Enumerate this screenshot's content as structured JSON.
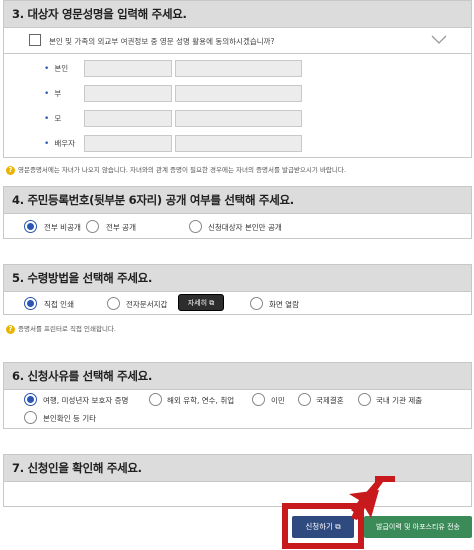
{
  "section3": {
    "title": "3. 대상자 영문성명을 입력해 주세요.",
    "consent_text": "본인 및 가족의 외교부 여권정보 중 영문 성명 활용에 동의하시겠습니까?",
    "rows": [
      {
        "label": "본인"
      },
      {
        "label": "부"
      },
      {
        "label": "모"
      },
      {
        "label": "배우자"
      }
    ],
    "note": "영문증명서에는 자녀가 나오지 않습니다. 자녀와의 관계 증명이 필요한 경우에는 자녀의 증명서를 발급받으시기 바랍니다."
  },
  "section4": {
    "title": "4. 주민등록번호(뒷부분 6자리) 공개 여부를 선택해 주세요.",
    "options": [
      {
        "label": "전부 비공개",
        "selected": true
      },
      {
        "label": "전부 공개",
        "selected": false
      },
      {
        "label": "신청대상자 본인만 공개",
        "selected": false
      }
    ]
  },
  "section5": {
    "title": "5. 수령방법을 선택해 주세요.",
    "options": [
      {
        "label": "직접 인쇄",
        "selected": true
      },
      {
        "label": "전자문서지갑",
        "selected": false
      },
      {
        "label": "화면 열람",
        "selected": false
      }
    ],
    "detail_button": "자세히 ⧉",
    "note": "증명서를 프린터로 직접 인쇄합니다."
  },
  "section6": {
    "title": "6. 신청사유를 선택해 주세요.",
    "options": [
      {
        "label": "여행, 미성년자 보호자 증명",
        "selected": true
      },
      {
        "label": "해외 유학, 연수, 취업",
        "selected": false
      },
      {
        "label": "이민",
        "selected": false
      },
      {
        "label": "국제결혼",
        "selected": false
      },
      {
        "label": "국내 기관 제출",
        "selected": false
      },
      {
        "label": "본인확인 등 기타",
        "selected": false
      }
    ]
  },
  "section7": {
    "title": "7. 신청인을 확인해 주세요."
  },
  "buttons": {
    "apply": "신청하기 ⧉",
    "history": "발급이력 및 아포스티유 전송"
  },
  "colors": {
    "accent": "#2b55b0",
    "apply_bg": "#2e4a7e",
    "history_bg": "#3a8b57",
    "highlight": "#c8191c"
  }
}
